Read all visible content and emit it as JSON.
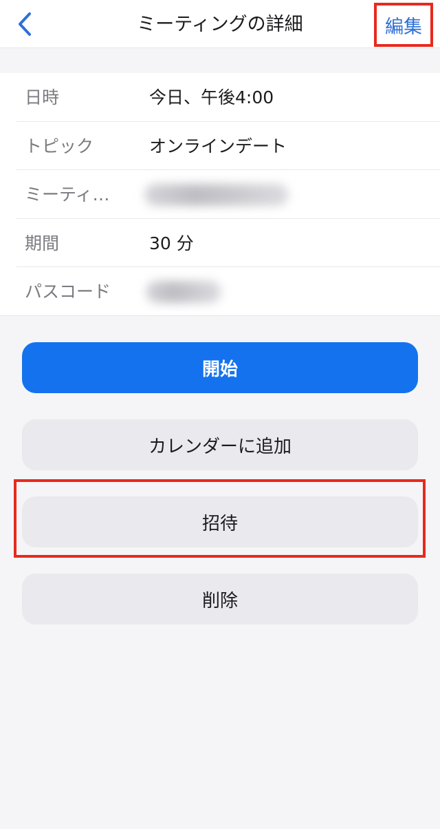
{
  "nav": {
    "title": "ミーティングの詳細",
    "edit_label": "編集"
  },
  "details": [
    {
      "label": "日時",
      "value": "今日、午後4:00"
    },
    {
      "label": "トピック",
      "value": "オンラインデート"
    },
    {
      "label": "ミーティ…",
      "value": ""
    },
    {
      "label": "期間",
      "value": "30 分"
    },
    {
      "label": "パスコード",
      "value": ""
    }
  ],
  "actions": {
    "start_label": "開始",
    "calendar_label": "カレンダーに追加",
    "invite_label": "招待",
    "delete_label": "削除"
  },
  "colors": {
    "primary": "#1472ee",
    "link": "#2f6fd6",
    "highlight": "#e8291c",
    "button_gray": "#e9e9ee"
  },
  "icons": {
    "back": "chevron-left-icon"
  }
}
